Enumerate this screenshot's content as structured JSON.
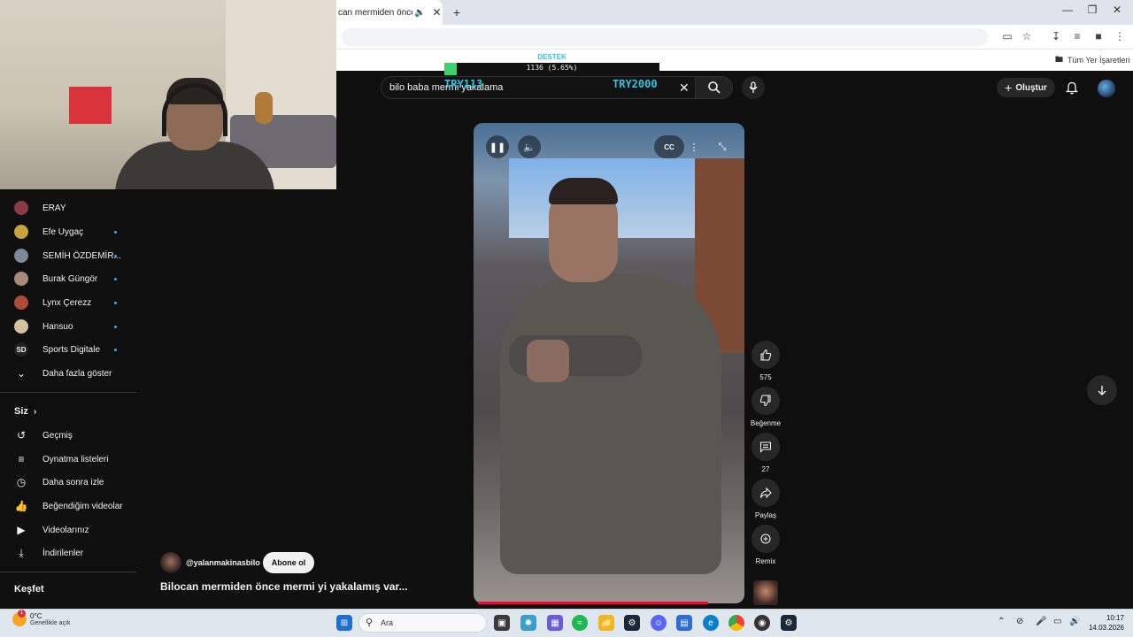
{
  "browser": {
    "tab_title": "can mermiden önce me",
    "bookmarks_all": "Tüm Yer İşaretleri"
  },
  "donation": {
    "label": "DESTEK",
    "progress_text": "1136 (5.65%)",
    "progress_fraction": 0.0565,
    "current": "TRY113",
    "goal": "TRY2000"
  },
  "youtube": {
    "search_query": "bilo baba mermi yakalama",
    "create_label": "Oluştur"
  },
  "sidebar": {
    "subscriptions": [
      {
        "label": "ERAY",
        "dot": false,
        "color": "#8a3a44"
      },
      {
        "label": "Efe Uygaç",
        "dot": true,
        "color": "#c9a23a"
      },
      {
        "label": "SEMİH ÖZDEMİR...",
        "dot": true,
        "color": "#7a8a99"
      },
      {
        "label": "Burak Güngör",
        "dot": true,
        "color": "#a88a7a"
      },
      {
        "label": "Lynx Çerezz",
        "dot": true,
        "color": "#b04a3a"
      },
      {
        "label": "Hansuo",
        "dot": true,
        "color": "#d2c2a0"
      },
      {
        "label": "Sports Digitale",
        "dot": true,
        "color": "#222222"
      }
    ],
    "show_more": "Daha fazla göster",
    "you_heading": "Siz",
    "you_items": [
      "Geçmiş",
      "Oynatma listeleri",
      "Daha sonra izle",
      "Beğendiğim videolar",
      "Videolarınız",
      "İndirilenler"
    ],
    "explore_heading": "Keşfet"
  },
  "short": {
    "channel": "@yalanmakinasbilo",
    "subscribe": "Abone ol",
    "title": "Bilocan mermiden önce mermi yi yakalamış var...",
    "likes": "575",
    "dislike": "Beğenme",
    "comments": "27",
    "share": "Paylaş",
    "remix": "Remix"
  },
  "taskbar": {
    "temp": "0°C",
    "weather": "Genellikle açık",
    "weather_badge": "1",
    "search": "Ara",
    "time": "10:17",
    "date": "14.03.2026"
  }
}
